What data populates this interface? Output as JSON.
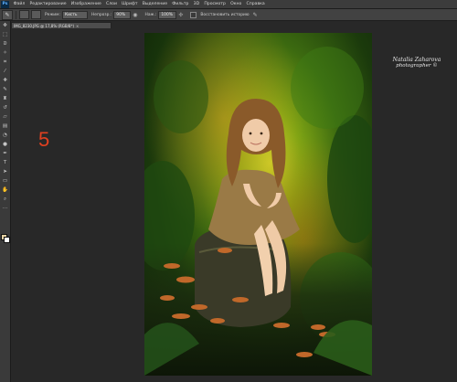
{
  "menubar": {
    "logo": "Ps",
    "items": [
      "Файл",
      "Редактирование",
      "Изображение",
      "Слои",
      "Шрифт",
      "Выделение",
      "Фильтр",
      "3D",
      "Просмотр",
      "Окно",
      "Справка"
    ]
  },
  "optionsbar": {
    "mode_label": "Режим:",
    "mode_value": "Кисть",
    "opacity_label": "Непрозр.:",
    "opacity_value": "90%",
    "press_label": "Наж.:",
    "press_value": "100%",
    "history_label": "Восстановить историю"
  },
  "document": {
    "tab_title": "IMG_8230.JPG @ 17,8% (RGB/8*)",
    "close_glyph": "×"
  },
  "canvas": {
    "step_number": "5",
    "watermark_name": "Natalia Zaharova",
    "watermark_sub": "photographer ©"
  },
  "colors": {
    "foreground": "#e8d3a3",
    "background": "#ffffff",
    "step_number": "#e04020"
  },
  "toolbox": {
    "tools": [
      "move-tool",
      "marquee-tool",
      "lasso-tool",
      "quick-select-tool",
      "crop-tool",
      "eyedropper-tool",
      "healing-tool",
      "brush-tool",
      "clone-stamp-tool",
      "history-brush-tool",
      "eraser-tool",
      "gradient-tool",
      "blur-tool",
      "dodge-tool",
      "pen-tool",
      "type-tool",
      "path-select-tool",
      "shape-tool",
      "hand-tool",
      "zoom-tool"
    ]
  }
}
